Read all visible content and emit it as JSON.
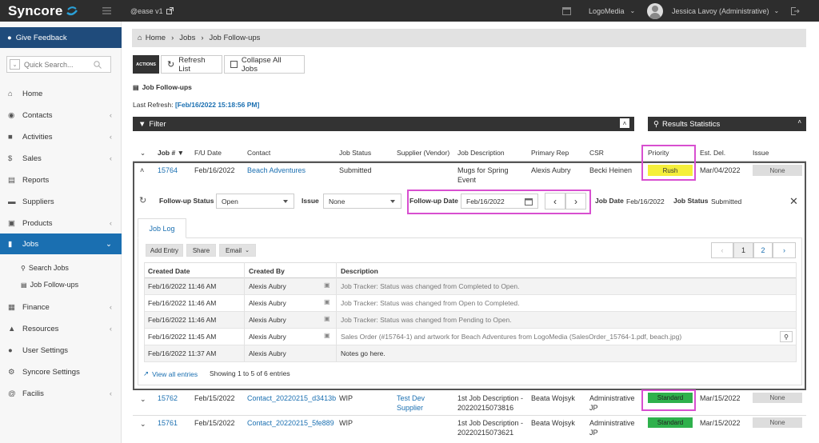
{
  "topbar": {
    "logo": "Syncore",
    "env_label": "@ease v1",
    "company": "LogoMedia",
    "user": "Jessica Lavoy (Administrative)"
  },
  "sidebar": {
    "feedback": "Give Feedback",
    "search_placeholder": "Quick Search...",
    "items": [
      {
        "label": "Home",
        "icon": "home-icon",
        "chevron": false
      },
      {
        "label": "Contacts",
        "icon": "contacts-icon",
        "chevron": true
      },
      {
        "label": "Activities",
        "icon": "activities-icon",
        "chevron": true
      },
      {
        "label": "Sales",
        "icon": "dollar-icon",
        "chevron": true
      },
      {
        "label": "Reports",
        "icon": "reports-icon",
        "chevron": false
      },
      {
        "label": "Suppliers",
        "icon": "truck-icon",
        "chevron": false
      },
      {
        "label": "Products",
        "icon": "gift-icon",
        "chevron": true
      },
      {
        "label": "Jobs",
        "icon": "folder-icon",
        "chevron": true,
        "active": true
      },
      {
        "label": "Finance",
        "icon": "finance-icon",
        "chevron": true
      },
      {
        "label": "Resources",
        "icon": "resources-icon",
        "chevron": true
      },
      {
        "label": "User Settings",
        "icon": "user-icon",
        "chevron": false
      },
      {
        "label": "Syncore Settings",
        "icon": "settings-icon",
        "chevron": false
      },
      {
        "label": "Facilis",
        "icon": "at-icon",
        "chevron": true
      }
    ],
    "sub_items": [
      "Search Jobs",
      "Job Follow-ups"
    ]
  },
  "breadcrumb": [
    "Home",
    "Jobs",
    "Job Follow-ups"
  ],
  "toolbar": {
    "actions": "ACTIONS",
    "refresh": "Refresh List",
    "collapse": "Collapse All Jobs"
  },
  "page": {
    "title": "Job Follow-ups",
    "last_refresh_label": "Last Refresh:",
    "last_refresh_value": "[Feb/16/2022 15:18:56 PM]",
    "filter": "Filter",
    "stats": "Results Statistics"
  },
  "table": {
    "headers": [
      "Job #",
      "F/U Date",
      "Contact",
      "Job Status",
      "Supplier (Vendor)",
      "Job Description",
      "Primary Rep",
      "CSR",
      "Priority",
      "Est. Del.",
      "Issue"
    ],
    "rows": [
      {
        "job": "15764",
        "fu_date": "Feb/16/2022",
        "contact": "Beach Adventures",
        "status": "Submitted",
        "supplier": "",
        "desc": "Mugs for Spring Event",
        "rep": "Alexis Aubry",
        "csr": "Becki Heinen",
        "priority": "Rush",
        "est": "Mar/04/2022",
        "issue": "None"
      },
      {
        "job": "15762",
        "fu_date": "Feb/15/2022",
        "contact": "Contact_20220215_d3413b",
        "status": "WIP",
        "supplier": "Test Dev Supplier",
        "desc": "1st Job Description - 20220215073816",
        "rep": "Beata Wojsyk",
        "csr": "Administrative JP",
        "priority": "Standard",
        "est": "Mar/15/2022",
        "issue": "None"
      },
      {
        "job": "15761",
        "fu_date": "Feb/15/2022",
        "contact": "Contact_20220215_5fe889",
        "status": "WIP",
        "supplier": "",
        "desc": "1st Job Description - 20220215073621",
        "rep": "Beata Wojsyk",
        "csr": "Administrative JP",
        "priority": "Standard",
        "est": "Mar/15/2022",
        "issue": "None"
      }
    ]
  },
  "detail": {
    "fu_status_label": "Follow-up Status",
    "fu_status_value": "Open",
    "issue_label": "Issue",
    "issue_value": "None",
    "fu_date_label": "Follow-up Date",
    "fu_date_value": "Feb/16/2022",
    "job_date_label": "Job Date",
    "job_date_value": "Feb/16/2022",
    "job_status_label": "Job Status",
    "job_status_value": "Submitted",
    "tab": "Job Log",
    "buttons": [
      "Add Entry",
      "Share",
      "Email"
    ],
    "pagination": [
      "1",
      "2"
    ],
    "log_headers": [
      "Created Date",
      "Created By",
      "Description"
    ],
    "log": [
      {
        "date": "Feb/16/2022 11:46 AM",
        "by": "Alexis Aubry",
        "desc": "Job Tracker: Status was changed from Completed to Open.",
        "sys": true
      },
      {
        "date": "Feb/16/2022 11:46 AM",
        "by": "Alexis Aubry",
        "desc": "Job Tracker: Status was changed from Open to Completed.",
        "sys": true
      },
      {
        "date": "Feb/16/2022 11:46 AM",
        "by": "Alexis Aubry",
        "desc": "Job Tracker: Status was changed from Pending to Open.",
        "sys": true
      },
      {
        "date": "Feb/16/2022 11:45 AM",
        "by": "Alexis Aubry",
        "desc": "Sales Order (#15764-1) and artwork for Beach Adventures from LogoMedia (SalesOrder_15764-1.pdf, beach.jpg)",
        "sys": true
      },
      {
        "date": "Feb/16/2022 11:37 AM",
        "by": "Alexis Aubry",
        "desc": "Notes go here.",
        "sys": false
      }
    ],
    "view_all": "View all entries",
    "showing": "Showing 1 to 5 of 6 entries"
  },
  "colors": {
    "accent": "#1a6fb1",
    "rush": "#f5ef3b",
    "standard": "#2fb14c",
    "highlight": "#d84fd0"
  }
}
